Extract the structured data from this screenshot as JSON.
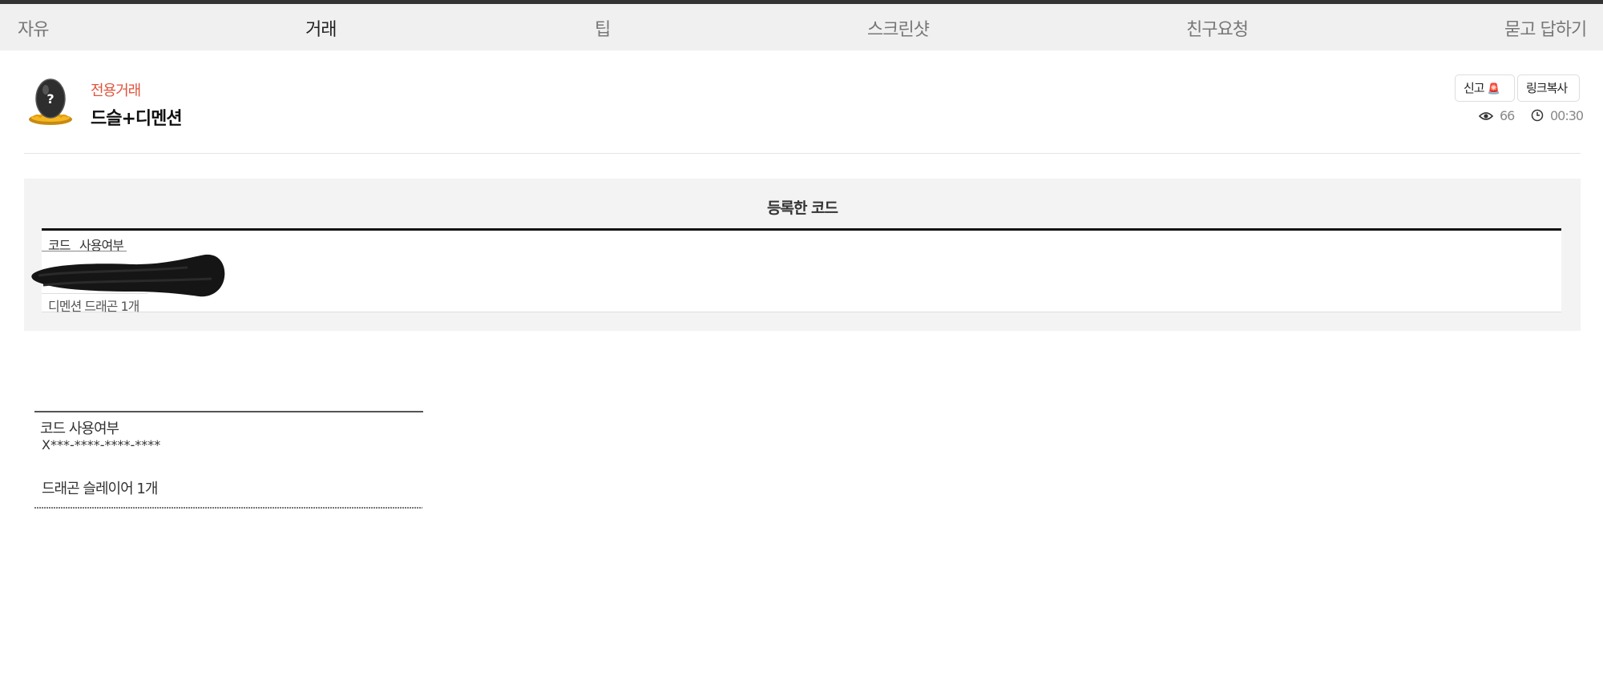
{
  "nav": {
    "items": [
      {
        "label": "자유",
        "active": false
      },
      {
        "label": "거래",
        "active": true
      },
      {
        "label": "팁",
        "active": false
      },
      {
        "label": "스크린샷",
        "active": false
      },
      {
        "label": "친구요청",
        "active": false
      },
      {
        "label": "묻고 답하기",
        "active": false
      }
    ],
    "active_underline_color": "#f2c200"
  },
  "post": {
    "category": "전용거래",
    "title": "드슬+디멘션",
    "avatar_icon": "mystery-egg-avatar",
    "report_label": "신고",
    "report_icon": "siren-icon",
    "copy_link_label": "링크복사",
    "views": "66",
    "time": "00:30",
    "category_color": "#e0533c"
  },
  "code_panel": {
    "title": "등록한 코드",
    "col_code": "코드",
    "col_usage": "사용여부",
    "reward": "디멘션 드래곤 1개"
  },
  "snippet": {
    "header": "코드 사용여부",
    "code": "X***-****-****-****",
    "reward": "드래곤 슬레이어 1개"
  }
}
